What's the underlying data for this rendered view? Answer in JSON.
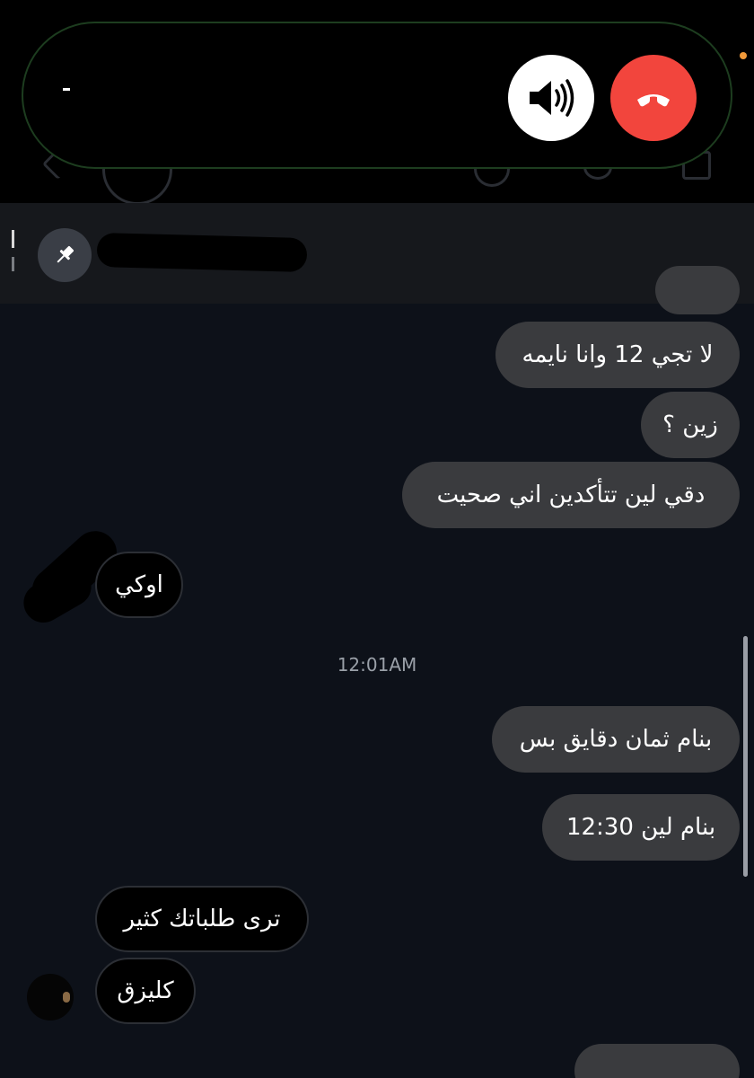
{
  "call": {
    "speaker_icon": "speaker-icon",
    "end_icon": "phone-hangup-icon",
    "end_color": "#f2453d",
    "indicator_color": "#f29a3a"
  },
  "pinned": {
    "icon": "pin-icon"
  },
  "messages": [
    {
      "direction": "out",
      "text": "لا تجي 12 وانا نايمه"
    },
    {
      "direction": "out",
      "text": "زين ؟"
    },
    {
      "direction": "out",
      "text": "دقي لين تتأكدين اني صحيت"
    },
    {
      "direction": "in",
      "text": "اوكي"
    },
    {
      "direction": "out",
      "text": "بنام ثمان دقايق بس"
    },
    {
      "direction": "out",
      "text": "بنام لين 12:30"
    },
    {
      "direction": "in",
      "text": "ترى طلباتك كثير"
    },
    {
      "direction": "in",
      "text": "كليزق"
    }
  ],
  "timestamp": "12:01AM"
}
